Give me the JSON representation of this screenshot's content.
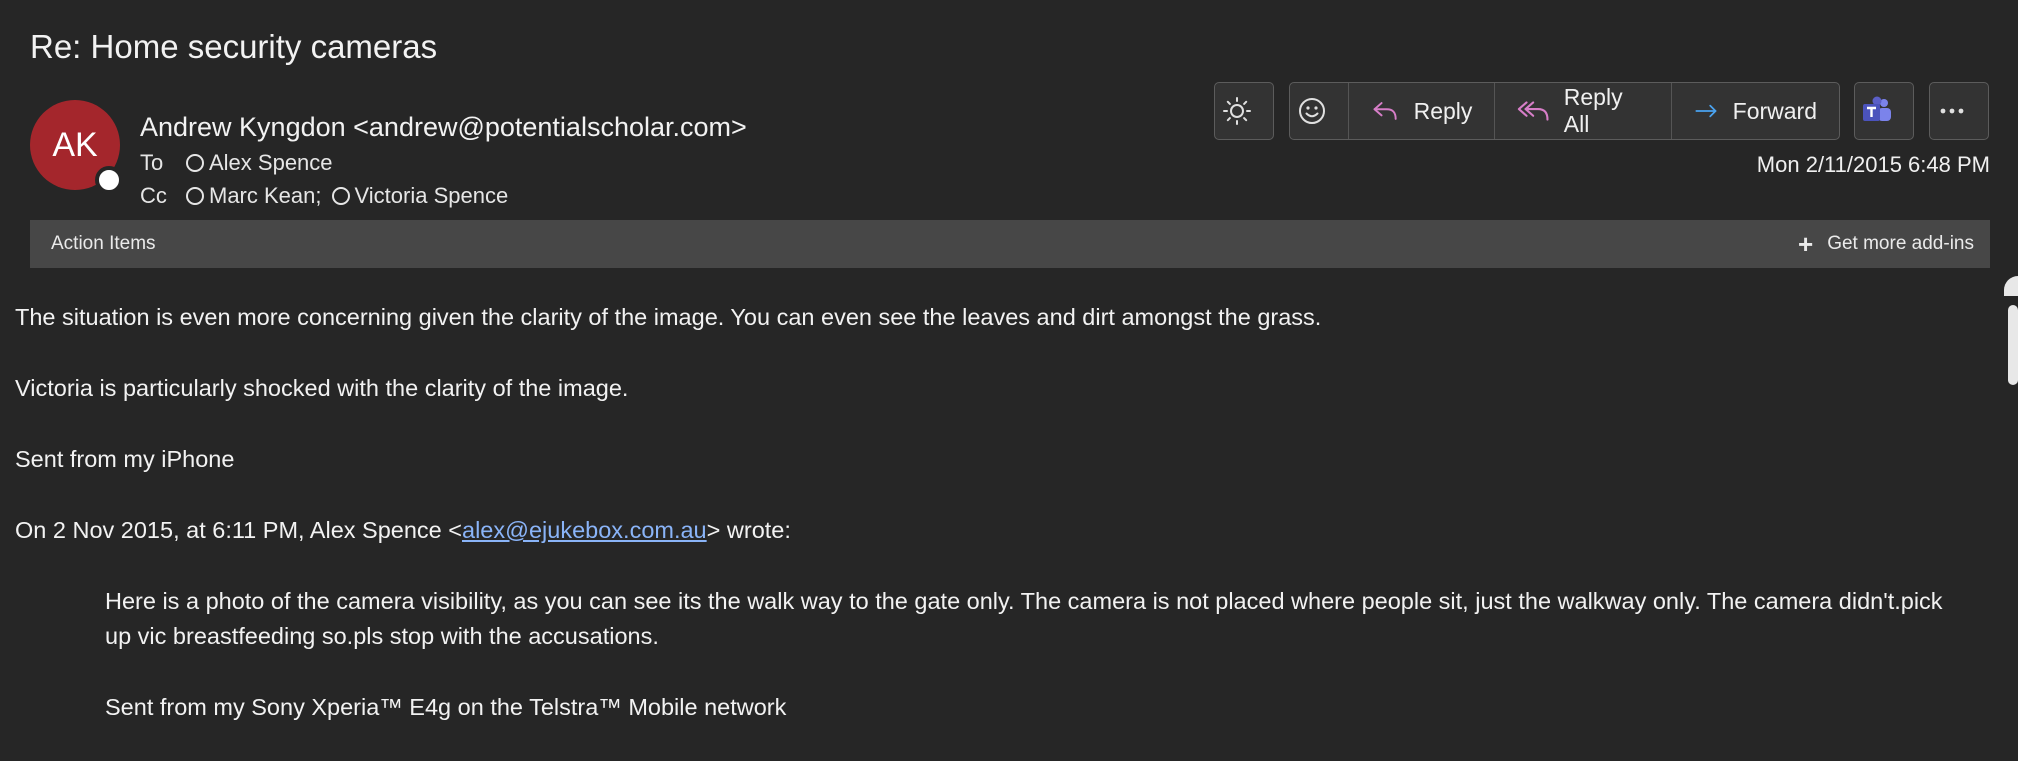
{
  "subject": "Re: Home security cameras",
  "avatar": {
    "initials": "AK"
  },
  "sender": "Andrew Kyngdon <andrew@potentialscholar.com>",
  "to": {
    "label": "To",
    "recipients": [
      "Alex Spence"
    ]
  },
  "cc": {
    "label": "Cc",
    "recipients": [
      "Marc Kean;",
      "Victoria Spence"
    ]
  },
  "toolbar": {
    "reply": "Reply",
    "reply_all": "Reply All",
    "forward": "Forward"
  },
  "datetime": "Mon 2/11/2015 6:48 PM",
  "addin_bar": {
    "label": "Action Items",
    "more": "Get more add-ins"
  },
  "body": {
    "p1": "The situation is even more concerning given the clarity of the image. You can even see the leaves and dirt amongst the grass.",
    "p2": "Victoria is particularly shocked with the clarity of the image.",
    "p3": "Sent from my iPhone",
    "p4_prefix": "On 2 Nov 2015, at 6:11 PM, Alex Spence <",
    "p4_link": "alex@ejukebox.com.au",
    "p4_suffix": "> wrote:",
    "q1": "Here is a photo of the camera visibility, as you can see its the walk way to the gate only. The camera is not placed where people sit, just the walkway only. The camera didn't.pick up vic breastfeeding so.pls stop with the accusations.",
    "q2": "Sent from my Sony Xperia™ E4g on the Telstra™ Mobile network"
  },
  "colors": {
    "background": "#262626",
    "avatar": "#a4262c",
    "reply_icon": "#d77ec8",
    "forward_icon": "#4aa3f0",
    "teams_icon": "#5b5fc7",
    "link": "#8ab4f8"
  },
  "icons": [
    "sun-icon",
    "emoji-icon",
    "reply-icon",
    "reply-all-icon",
    "forward-icon",
    "teams-icon",
    "more-icon",
    "plus-icon"
  ]
}
